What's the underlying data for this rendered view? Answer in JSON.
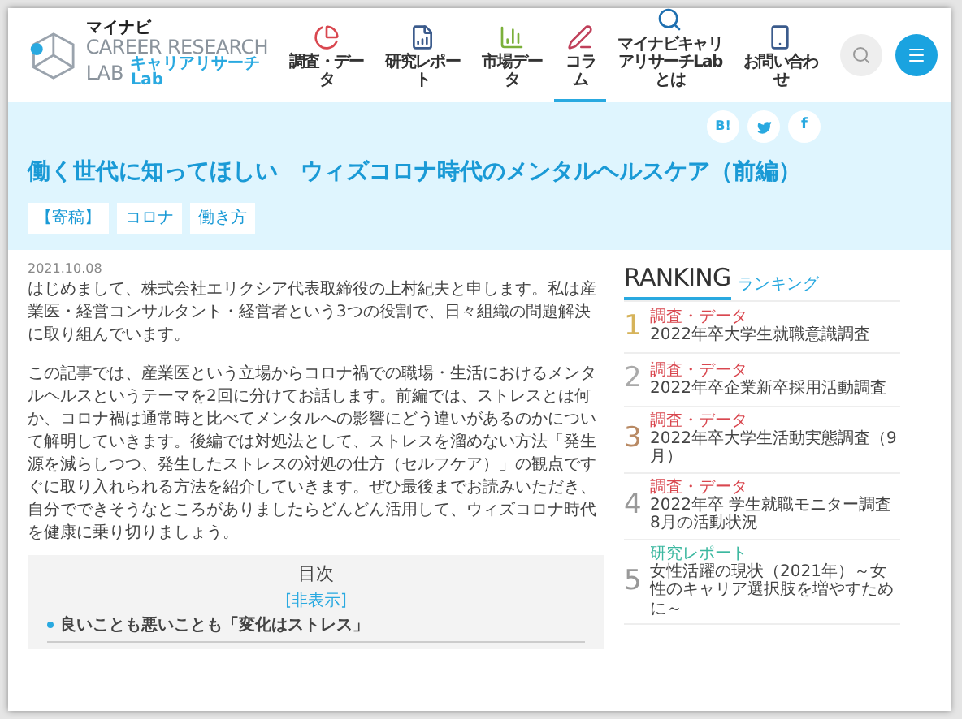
{
  "header": {
    "logo": {
      "brand": "マイナビ",
      "name_line1": "CAREER RESEARCH",
      "name_line2": "LAB",
      "subtitle": "キャリアリサーチLab"
    },
    "nav": [
      {
        "label": "調査・データ",
        "kind": "pie",
        "selected": false
      },
      {
        "label": "研究レポート",
        "kind": "report",
        "selected": false
      },
      {
        "label": "市場データ",
        "kind": "chart",
        "selected": false
      },
      {
        "label": "コラム",
        "kind": "pen",
        "selected": true
      },
      {
        "label": "マイナビキャリアリサーチLabとは",
        "kind": "search",
        "selected": false
      },
      {
        "label": "お問い合わせ",
        "kind": "phone",
        "selected": false
      }
    ]
  },
  "share": {
    "hatena": "B!",
    "facebook": "f"
  },
  "article": {
    "title": "働く世代に知ってほしい　ウィズコロナ時代のメンタルヘルスケア（前編）",
    "tags": [
      "【寄稿】",
      "コロナ",
      "働き方"
    ],
    "date": "2021.10.08",
    "paragraphs": [
      "はじめまして、株式会社エリクシア代表取締役の上村紀夫と申します。私は産業医・経営コンサルタント・経営者という3つの役割で、日々組織の問題解決に取り組んでいます。",
      "この記事では、産業医という立場からコロナ禍での職場・生活におけるメンタルヘルスというテーマを2回に分けてお話します。前編では、ストレスとは何か、コロナ禍は通常時と比べてメンタルへの影響にどう違いがあるのかについて解明していきます。後編では対処法として、ストレスを溜めない方法「発生源を減らしつつ、発生したストレスの対処の仕方（セルフケア）」の観点ですぐに取り入れられる方法を紹介していきます。ぜひ最後までお読みいただき、自分でできそうなところがありましたらどんどん活用して、ウィズコロナ時代を健康に乗り切りましょう。"
    ],
    "toc": {
      "title": "目次",
      "toggle": "[非表示]",
      "items": [
        "良いことも悪いことも「変化はストレス」"
      ]
    }
  },
  "ranking": {
    "title": "RANKING",
    "subtitle": "ランキング",
    "items": [
      {
        "rank": "1",
        "category": "調査・データ",
        "color": "#d9474f",
        "title": "2022年卒大学生就職意識調査"
      },
      {
        "rank": "2",
        "category": "調査・データ",
        "color": "#d9474f",
        "title": "2022年卒企業新卒採用活動調査"
      },
      {
        "rank": "3",
        "category": "調査・データ",
        "color": "#d9474f",
        "title": "2022年卒大学生活動実態調査（9月）"
      },
      {
        "rank": "4",
        "category": "調査・データ",
        "color": "#d9474f",
        "title": "2022年卒 学生就職モニター調査　8月の活動状況"
      },
      {
        "rank": "5",
        "category": "研究レポート",
        "color": "#3cb8a0",
        "title": "女性活躍の現状（2021年）～女性のキャリア選択肢を増やすために～"
      }
    ]
  }
}
